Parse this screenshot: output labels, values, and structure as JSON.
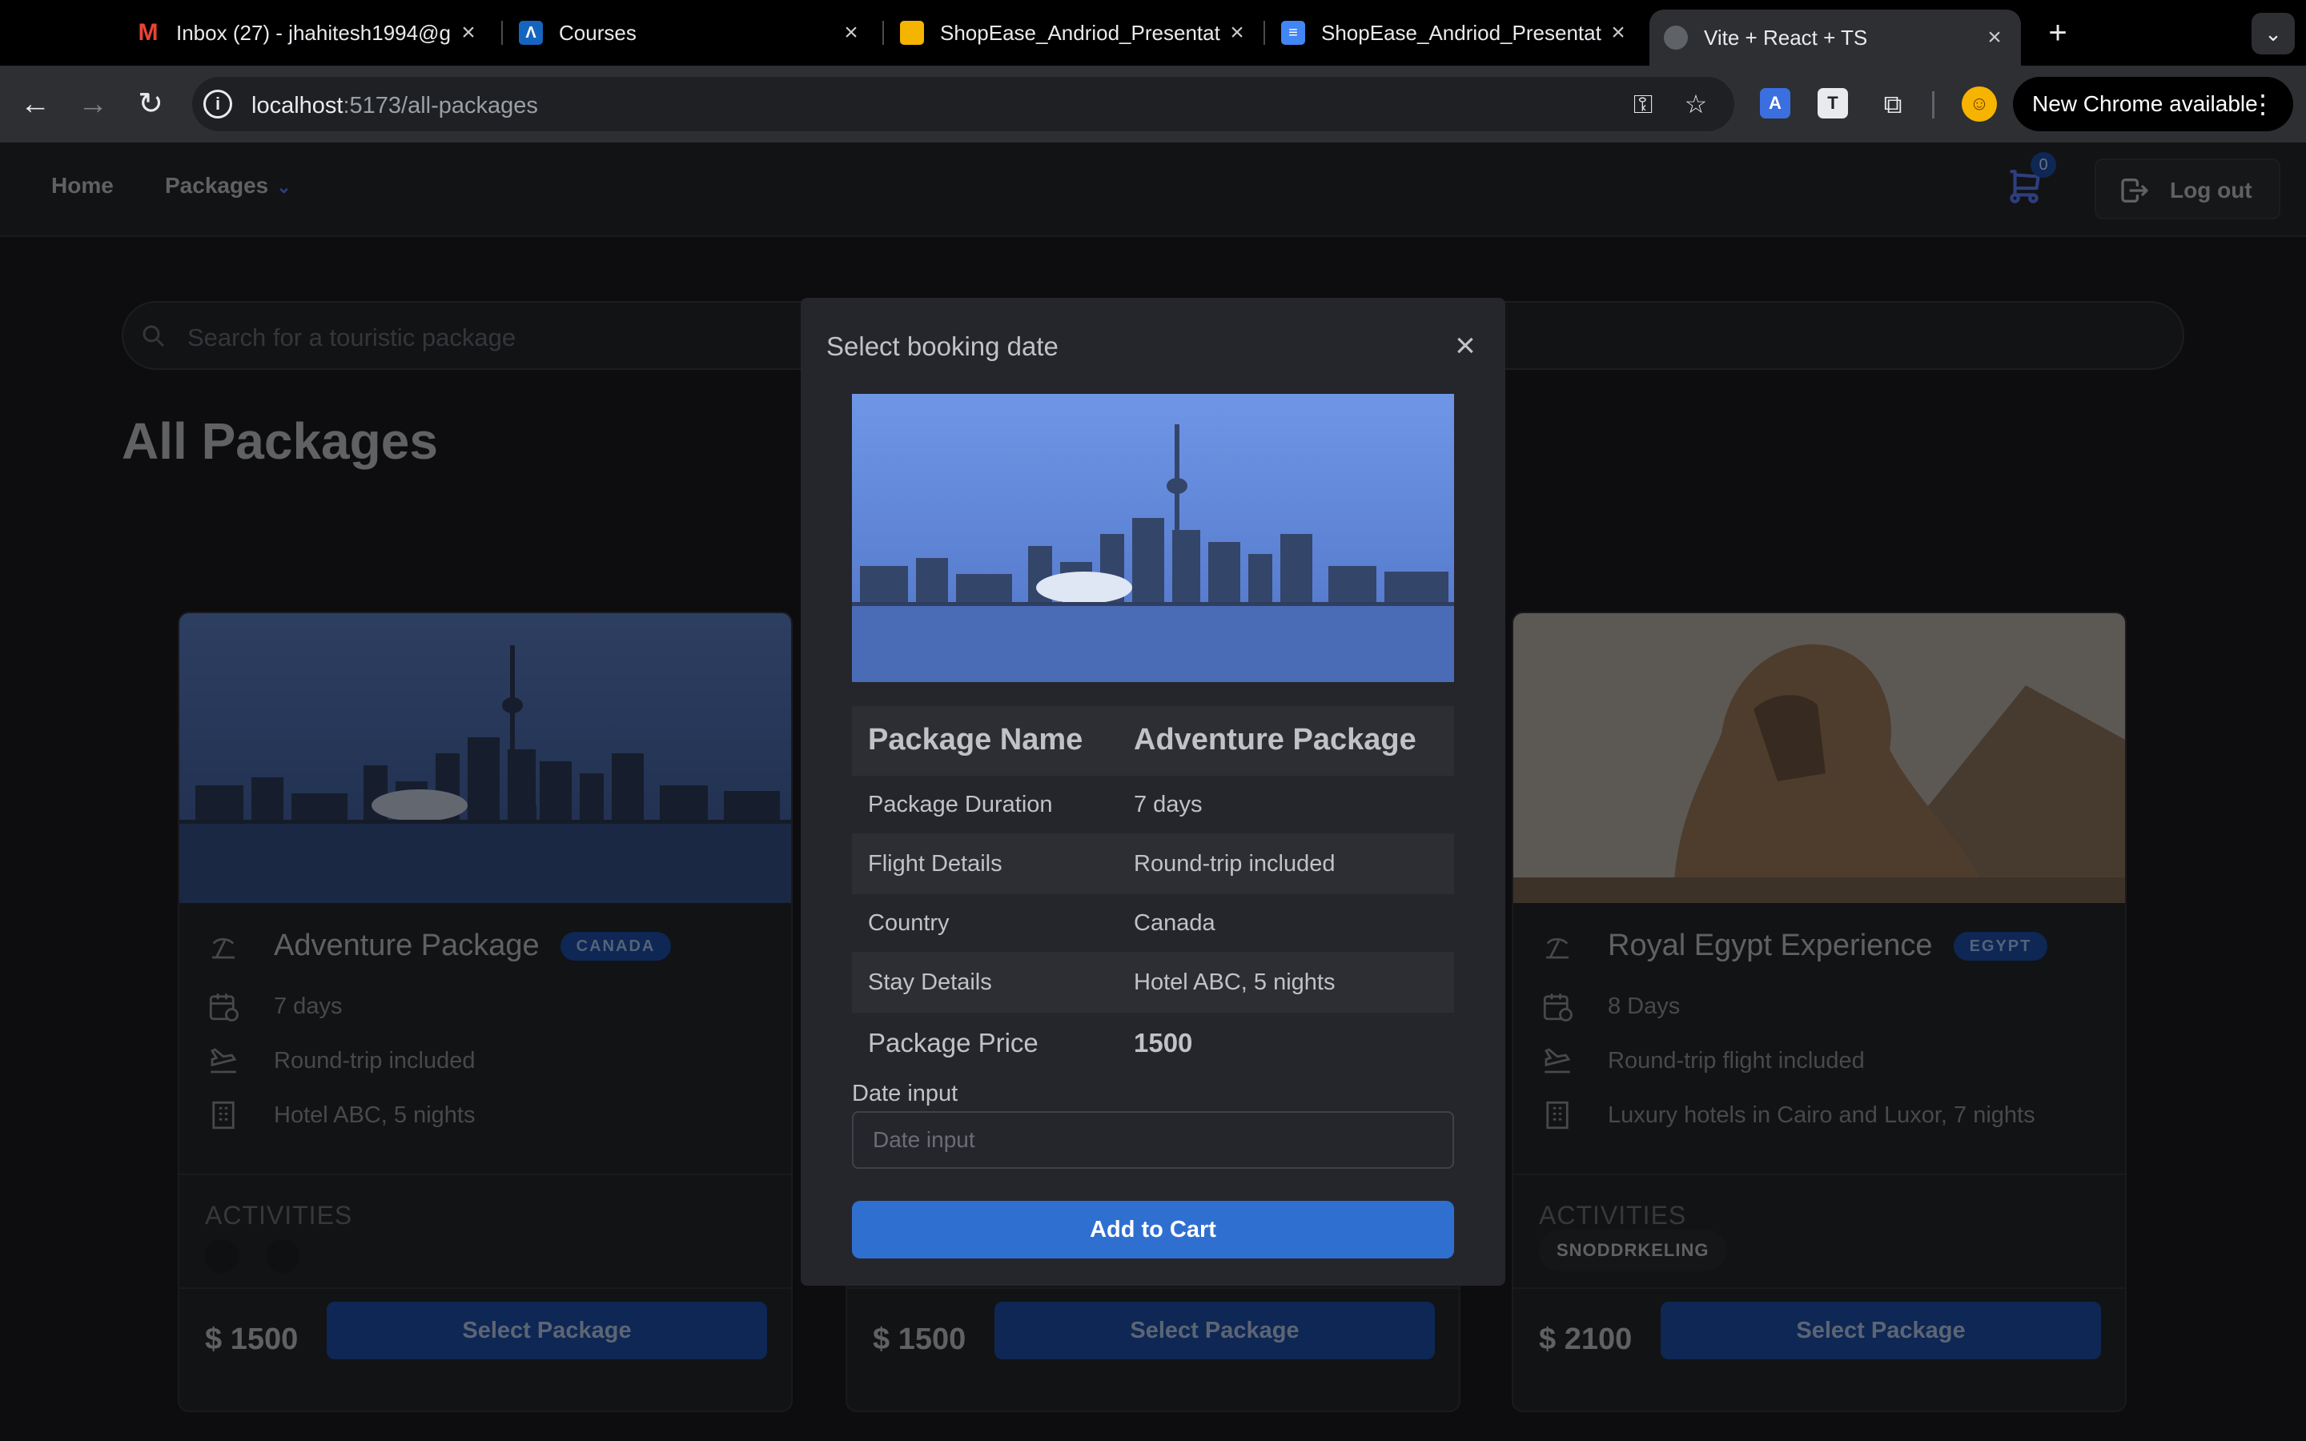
{
  "browser": {
    "tabs": [
      {
        "title": "Inbox (27) - jhahitesh1994@g",
        "icon": "gmail-icon"
      },
      {
        "title": "Courses",
        "icon": "courses-icon"
      },
      {
        "title": "ShopEase_Andriod_Presentat",
        "icon": "slides-icon"
      },
      {
        "title": "ShopEase_Andriod_Presentat",
        "icon": "docs-icon"
      },
      {
        "title": "Vite + React + TS",
        "icon": "globe-icon",
        "active": true
      }
    ],
    "url_host": "localhost",
    "url_path": ":5173/all-packages",
    "new_chrome": "New Chrome available"
  },
  "header": {
    "home": "Home",
    "packages": "Packages",
    "cart_count": "0",
    "logout": "Log out"
  },
  "search": {
    "placeholder": "Search for a touristic package"
  },
  "page_title": "All Packages",
  "activities_label": "ACTIVITIES",
  "select_label": "Select Package",
  "cards": [
    {
      "name": "Adventure Package",
      "country": "CANADA",
      "duration": "7 days",
      "flight": "Round-trip included",
      "stay": "Hotel ABC, 5 nights",
      "price": "$ 1500",
      "activities": []
    },
    {
      "name": "",
      "country": "",
      "duration": "",
      "flight": "",
      "stay": "",
      "price": "$ 1500",
      "activities": []
    },
    {
      "name": "Royal Egypt Experience",
      "country": "EGYPT",
      "duration": "8 Days",
      "flight": "Round-trip flight included",
      "stay": "Luxury hotels in Cairo and Luxor, 7 nights",
      "price": "$ 2100",
      "activities": [
        "SNODDRKELING"
      ]
    }
  ],
  "modal": {
    "title": "Select booking date",
    "table": {
      "head": [
        "Package Name",
        "Adventure Package"
      ],
      "rows": [
        [
          "Package Duration",
          "7 days"
        ],
        [
          "Flight Details",
          "Round-trip included"
        ],
        [
          "Country",
          "Canada"
        ],
        [
          "Stay Details",
          "Hotel ABC, 5 nights"
        ]
      ],
      "foot": [
        "Package Price",
        "1500"
      ]
    },
    "date_label": "Date input",
    "date_placeholder": "Date input",
    "add_to_cart": "Add to Cart"
  },
  "colors": {
    "accent": "#2f6fd0",
    "badge": "#1c4fa8",
    "background": "#1a1b1e",
    "surface": "#25262b"
  }
}
